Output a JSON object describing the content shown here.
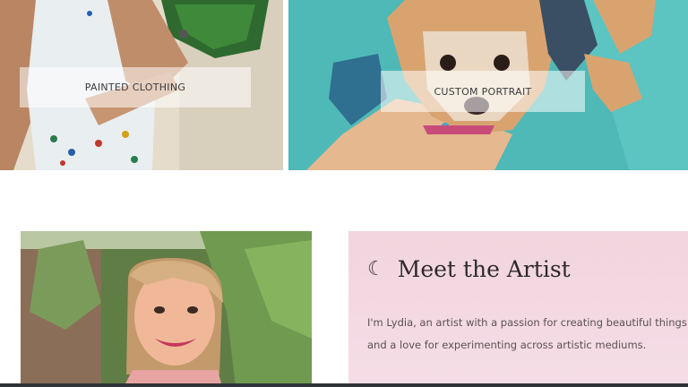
{
  "gallery": {
    "tiles": [
      {
        "label": "PAINTED CLOTHING"
      },
      {
        "label": "CUSTOM PORTRAIT"
      }
    ]
  },
  "artist": {
    "icon": "crescent-moon-icon",
    "heading": "Meet the Artist",
    "bio_lines": [
      "I'm Lydia, an artist with a passion for creating beautiful things",
      "and a love for experimenting across artistic mediums."
    ]
  },
  "colors": {
    "card_background": "#f2d5de",
    "portrait_background": "#4fb9b8"
  }
}
